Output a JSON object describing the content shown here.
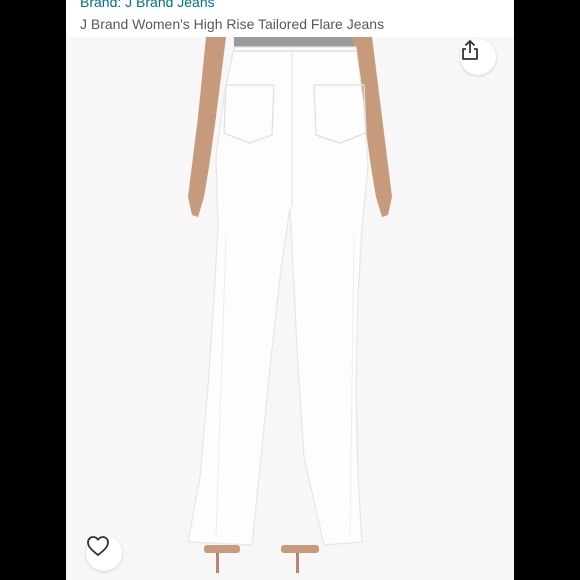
{
  "product": {
    "brand_link": "Brand: J Brand Jeans",
    "title": "J Brand Women's High Rise Tailored Flare Jeans"
  },
  "image": {
    "alt": "White high rise tailored flare jeans, rear view",
    "product_color": "#fdfdfd",
    "background_color": "#f7f7f7"
  },
  "actions": {
    "share_icon": "share-icon",
    "favorite_icon": "heart-icon"
  },
  "colors": {
    "link": "#007185",
    "text": "#565959",
    "side_panels": "#000000"
  }
}
